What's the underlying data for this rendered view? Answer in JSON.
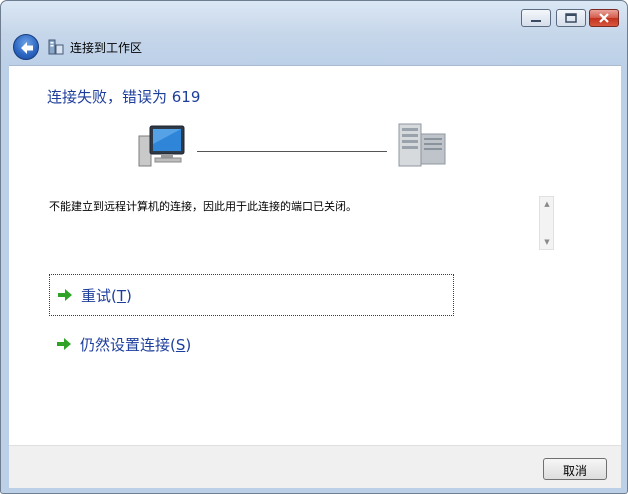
{
  "window": {
    "title": "连接到工作区",
    "controls": [
      "minimize-icon",
      "maximize-icon",
      "close-icon"
    ]
  },
  "header": {
    "back_icon": "back-arrow-icon",
    "network_icon": "workplace-network-icon"
  },
  "main": {
    "title": "连接失败，错误为 619",
    "description": "不能建立到远程计算机的连接，因此用于此连接的端口已关闭。",
    "local_icon": "computer-icon",
    "remote_icon": "server-icon"
  },
  "options": [
    {
      "label_prefix": "重试(",
      "label_accel": "T",
      "label_suffix": ")",
      "icon": "green-arrow-icon"
    },
    {
      "label_prefix": "仍然设置连接(",
      "label_accel": "S",
      "label_suffix": ")",
      "icon": "green-arrow-icon"
    }
  ],
  "footer": {
    "cancel_label": "取消"
  },
  "colors": {
    "title_blue": "#1e3e9c",
    "option_arrow_green": "#2ea326",
    "frame_blue": "#bcd0e8"
  }
}
